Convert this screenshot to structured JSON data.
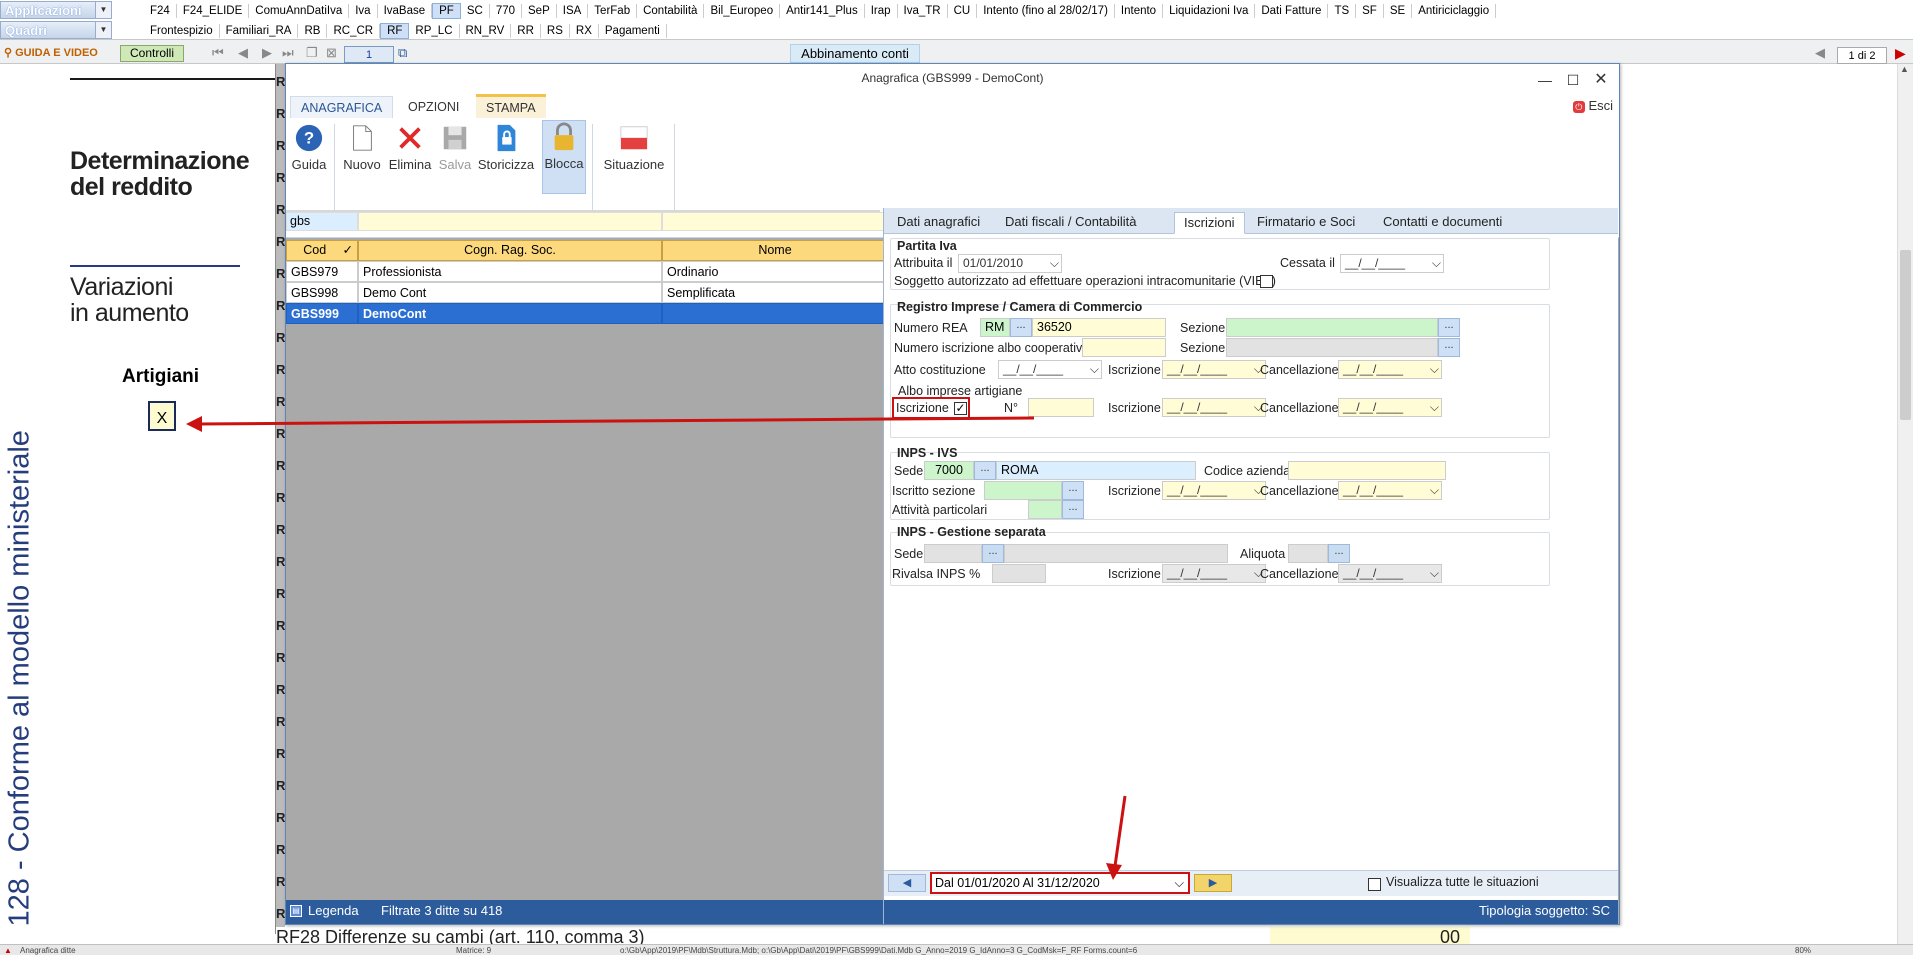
{
  "topbar": {
    "applicazioni_label": "Applicazioni",
    "quadri_label": "Quadri",
    "row1": [
      "F24",
      "F24_ELIDE",
      "ComuAnnDatiIva",
      "Iva",
      "IvaBase",
      "PF",
      "SC",
      "770",
      "SeP",
      "ISA",
      "TerFab",
      "Contabilità",
      "Bil_Europeo",
      "Antir141_Plus",
      "Irap",
      "Iva_TR",
      "CU",
      "Intento (fino al 28/02/17)",
      "Intento",
      "Liquidazioni Iva",
      "Dati Fatture",
      "TS",
      "SF",
      "SE",
      "Antiriciclaggio"
    ],
    "row1_active": "PF",
    "row2": [
      "Frontespizio",
      "Familiari_RA",
      "RB",
      "RC_CR",
      "RF",
      "RP_LC",
      "RN_RV",
      "RR",
      "RS",
      "RX",
      "Pagamenti"
    ],
    "row2_active": "RF"
  },
  "toolbar": {
    "guida_label": "GUIDA E VIDEO",
    "controlli_label": "Controlli",
    "page_number": "1",
    "abbinamento_label": "Abbinamento conti",
    "page_of": "1 di 2"
  },
  "document": {
    "heading1_line1": "Determinazione",
    "heading1_line2": "del reddito",
    "heading2_line1": "Variazioni",
    "heading2_line2": "in aumento",
    "artigiani_label": "Artigiani",
    "artigiani_value": "X",
    "vertical_text": "128 - Conforme al modello ministeriale",
    "bottom_text": "RF28  Differenze su cambi (art. 110, comma 3)",
    "bottom_right_value": "00",
    "status_left": "Anagrafica ditte",
    "status_mid": "Matrice: 9",
    "status_path": "o:\\Gb\\App\\2019\\PF\\Mdb\\Struttura.Mdb; o:\\Gb\\App\\Dati\\2019\\PF\\GBS999\\Dati.Mdb G_Anno=2019 G_IdAnno=3 G_CodMsk=F_RF Forms.count=6",
    "status_zoom": "80%"
  },
  "window": {
    "title": "Anagrafica (GBS999 - DemoCont)",
    "esci_label": "Esci",
    "ribbon_tabs": [
      "ANAGRAFICA",
      "OPZIONI",
      "STAMPA"
    ],
    "buttons": {
      "guida": "Guida",
      "nuovo": "Nuovo",
      "elimina": "Elimina",
      "salva": "Salva",
      "storicizza": "Storicizza",
      "blocca": "Blocca",
      "situazione": "Situazione"
    },
    "search_value": "gbs",
    "grid": {
      "headers": [
        "Cod",
        "Cogn. Rag. Soc.",
        "Nome"
      ],
      "rows": [
        {
          "cod": "GBS979",
          "name": "Professionista",
          "nome": "Ordinario"
        },
        {
          "cod": "GBS998",
          "name": "Demo Cont",
          "nome": "Semplificata"
        },
        {
          "cod": "GBS999",
          "name": "DemoCont",
          "nome": ""
        }
      ],
      "selected_index": 2
    },
    "legenda_label": "Legenda",
    "filter_status": "Filtrate 3 ditte su 418",
    "tipologia": "Tipologia soggetto: SC"
  },
  "detail": {
    "tabs": [
      "Dati anagrafici",
      "Dati fiscali / Contabilità",
      "Iscrizioni",
      "Firmatario e Soci",
      "Contatti e documenti"
    ],
    "active_tab": "Iscrizioni",
    "partita_iva": {
      "title": "Partita Iva",
      "attribuita_label": "Attribuita il",
      "attribuita_value": "01/01/2010",
      "cessata_label": "Cessata il",
      "cessata_value": "__/__/____",
      "vies_label": "Soggetto autorizzato ad effettuare operazioni intracomunitarie (VIES)"
    },
    "registro": {
      "title": "Registro Imprese / Camera di Commercio",
      "rea_label": "Numero REA",
      "rea_prov": "RM",
      "rea_value": "36520",
      "sezione_label": "Sezione",
      "albo_coop_label": "Numero iscrizione albo cooperative",
      "atto_label": "Atto costituzione",
      "atto_value": "__/__/____",
      "iscrizione_label": "Iscrizione",
      "cancellazione_label": "Cancellazione",
      "empty_date": "__/__/____",
      "albo_artigiane_label": "Albo imprese artigiane",
      "iscrizione_chk_label": "Iscrizione",
      "numero_label": "N°"
    },
    "inps_ivs": {
      "title": "INPS - IVS",
      "sede_label": "Sede",
      "sede_code": "7000",
      "sede_name": "ROMA",
      "codice_azienda_label": "Codice azienda",
      "iscritto_sezione_label": "Iscritto sezione",
      "attivita_label": "Attività particolari"
    },
    "inps_gs": {
      "title": "INPS - Gestione separata",
      "sede_label": "Sede",
      "aliquota_label": "Aliquota",
      "rivalsa_label": "Rivalsa INPS %"
    },
    "period_value": "Dal 01/01/2020 Al 31/12/2020",
    "visualizza_label": "Visualizza tutte le situazioni"
  },
  "colors": {
    "accent_blue": "#2d5c9c",
    "highlight_red": "#cc1111",
    "input_yellow": "#fffcd6",
    "input_green": "#ccf5cc"
  }
}
